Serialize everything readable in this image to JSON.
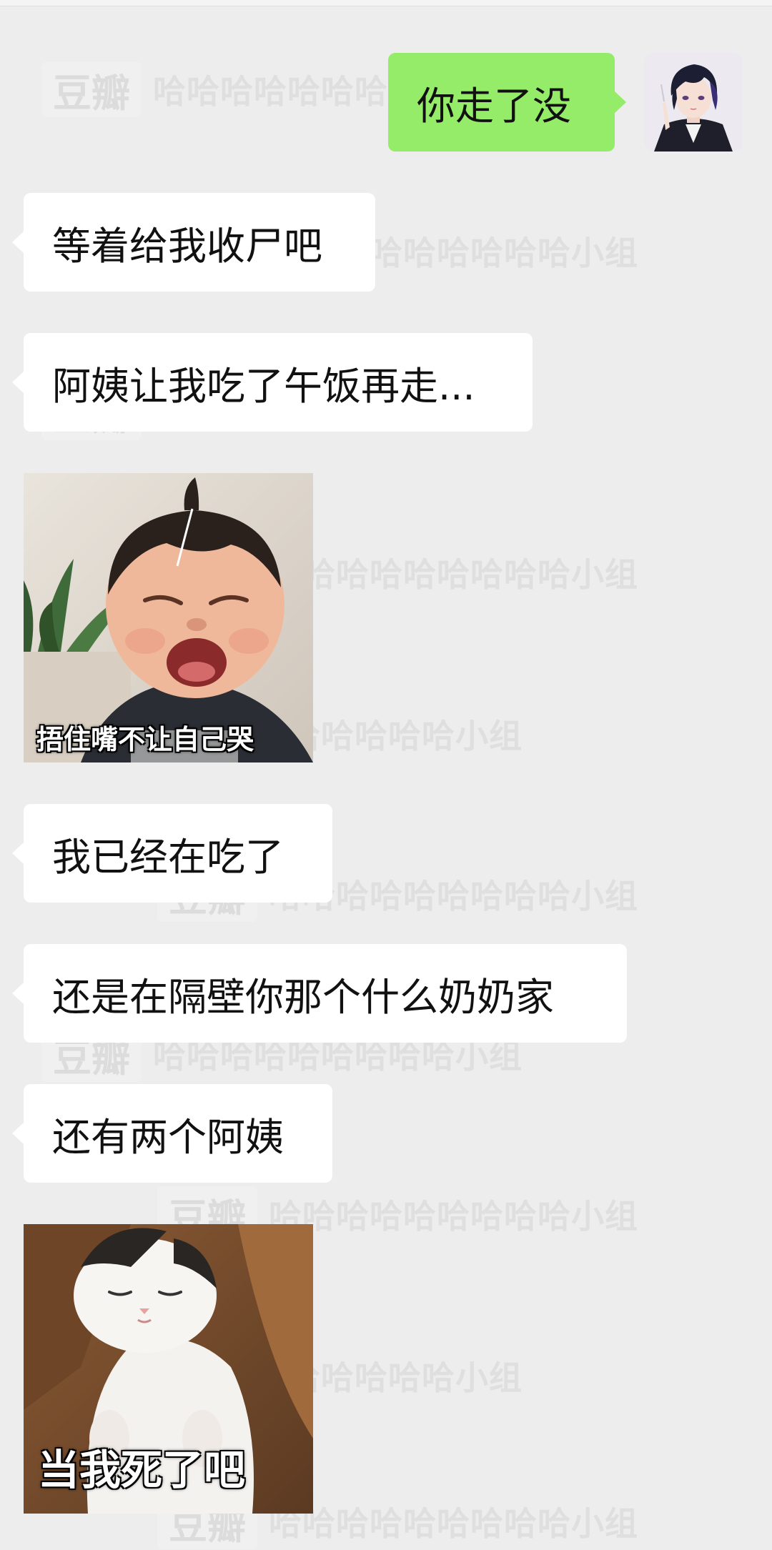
{
  "watermark": {
    "logo": "豆瓣",
    "text": "哈哈哈哈哈哈哈哈哈小组"
  },
  "messages": [
    {
      "side": "out",
      "text": "你走了没"
    },
    {
      "side": "in",
      "text": "等着给我收尸吧"
    },
    {
      "side": "in",
      "text": "阿姨让我吃了午饭再走..."
    },
    {
      "side": "in",
      "sticker": "crying-baby",
      "caption": "捂住嘴不让自己哭"
    },
    {
      "side": "in",
      "text": "我已经在吃了"
    },
    {
      "side": "in",
      "text": "还是在隔壁你那个什么奶奶家"
    },
    {
      "side": "in",
      "text": "还有两个阿姨"
    },
    {
      "side": "in",
      "sticker": "sleepy-cat",
      "caption": "当我死了吧"
    }
  ],
  "colors": {
    "background": "#ededed",
    "outgoing_bubble": "#95ec69",
    "incoming_bubble": "#ffffff"
  }
}
